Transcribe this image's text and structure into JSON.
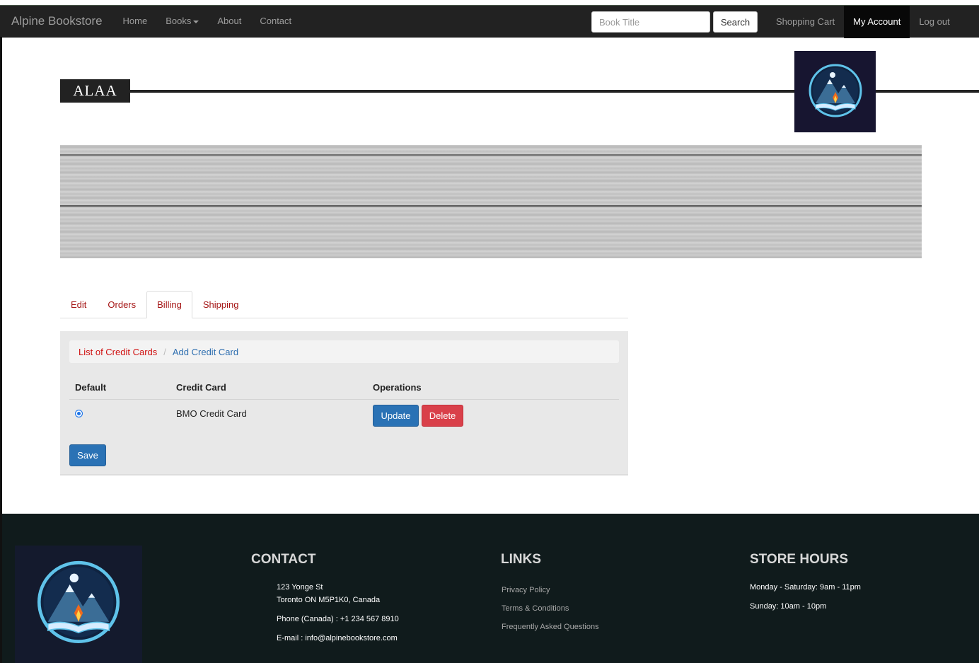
{
  "navbar": {
    "brand": "Alpine Bookstore",
    "links": [
      "Home",
      "Books",
      "About",
      "Contact"
    ],
    "search_placeholder": "Book Title",
    "search_button": "Search",
    "right_links": [
      "Shopping Cart",
      "My Account",
      "Log out"
    ]
  },
  "header": {
    "name": "ALAA"
  },
  "tabs": [
    "Edit",
    "Orders",
    "Billing",
    "Shipping"
  ],
  "active_tab": "Billing",
  "billing": {
    "breadcrumb_active": "List of Credit Cards",
    "breadcrumb_link": "Add Credit Card",
    "columns": [
      "Default",
      "Credit Card",
      "Operations"
    ],
    "rows": [
      {
        "card": "BMO Credit Card",
        "default": true,
        "update": "Update",
        "delete": "Delete"
      }
    ],
    "save": "Save"
  },
  "footer": {
    "contact_heading": "CONTACT",
    "address_line1": "123 Yonge St",
    "address_line2": "Toronto ON M5P1K0, Canada",
    "phone": "Phone (Canada) : +1 234 567 8910",
    "email": "E-mail : info@alpinebookstore.com",
    "links_heading": "LINKS",
    "links": [
      "Privacy Policy",
      "Terms & Conditions",
      "Frequently Asked Questions"
    ],
    "hours_heading": "STORE HOURS",
    "hours_weekday": "Monday - Saturday: 9am - 11pm",
    "hours_sunday": "Sunday: 10am - 10pm"
  },
  "colors": {
    "navbar": "#222222",
    "tab_link": "#a51515",
    "primary_button": "#2a72b5",
    "danger_button": "#d9404a",
    "footer_bg": "#101b1c"
  }
}
